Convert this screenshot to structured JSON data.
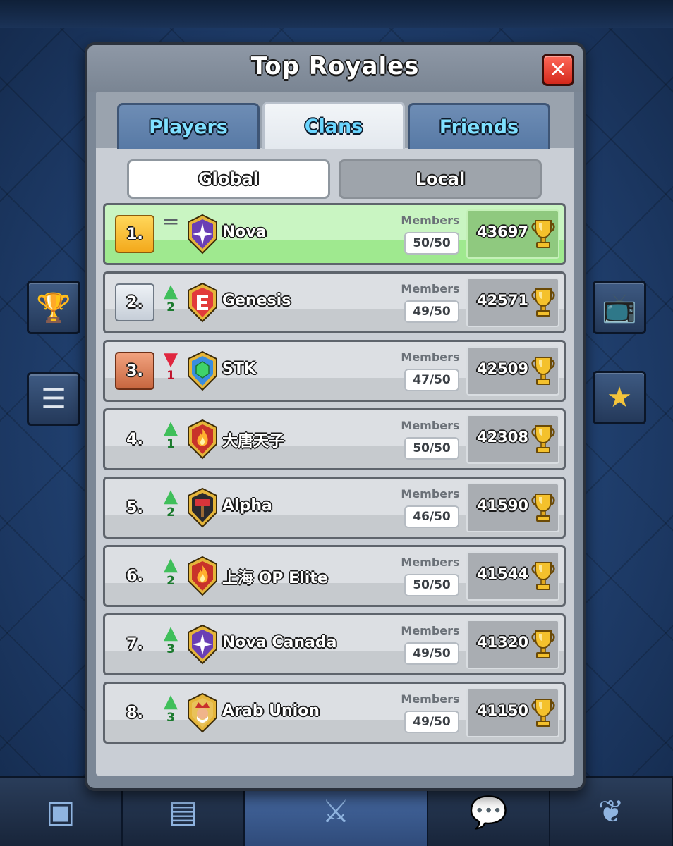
{
  "modal": {
    "title": "Top Royales",
    "tabs": [
      {
        "label": "Players",
        "active": false
      },
      {
        "label": "Clans",
        "active": true
      },
      {
        "label": "Friends",
        "active": false
      }
    ],
    "segments": [
      {
        "label": "Global",
        "active": true
      },
      {
        "label": "Local",
        "active": false
      }
    ],
    "members_label": "Members"
  },
  "clans": [
    {
      "rank": "1.",
      "change_dir": "same",
      "change": "",
      "name": "Nova",
      "badge": "star-purple",
      "members": "50/50",
      "trophies": "43697"
    },
    {
      "rank": "2.",
      "change_dir": "up",
      "change": "2",
      "name": "Genesis",
      "badge": "e-red",
      "members": "49/50",
      "trophies": "42571"
    },
    {
      "rank": "3.",
      "change_dir": "down",
      "change": "1",
      "name": "STK",
      "badge": "gem-blue",
      "members": "47/50",
      "trophies": "42509"
    },
    {
      "rank": "4.",
      "change_dir": "up",
      "change": "1",
      "name": "大唐天子",
      "badge": "fire-red",
      "members": "50/50",
      "trophies": "42308"
    },
    {
      "rank": "5.",
      "change_dir": "up",
      "change": "2",
      "name": "Alpha",
      "badge": "hammer-black",
      "members": "46/50",
      "trophies": "41590"
    },
    {
      "rank": "6.",
      "change_dir": "up",
      "change": "2",
      "name": "上海 OP Elite",
      "badge": "fire-red",
      "members": "50/50",
      "trophies": "41544"
    },
    {
      "rank": "7.",
      "change_dir": "up",
      "change": "3",
      "name": "Nova Canada",
      "badge": "star-purple",
      "members": "49/50",
      "trophies": "41320"
    },
    {
      "rank": "8.",
      "change_dir": "up",
      "change": "3",
      "name": "Arab Union",
      "badge": "king-gold",
      "members": "49/50",
      "trophies": "41150"
    }
  ],
  "colors": {
    "accent_tab_text": "#7fe0ff",
    "first_row": "#c9f5c2",
    "close_button": "#e0372a"
  }
}
